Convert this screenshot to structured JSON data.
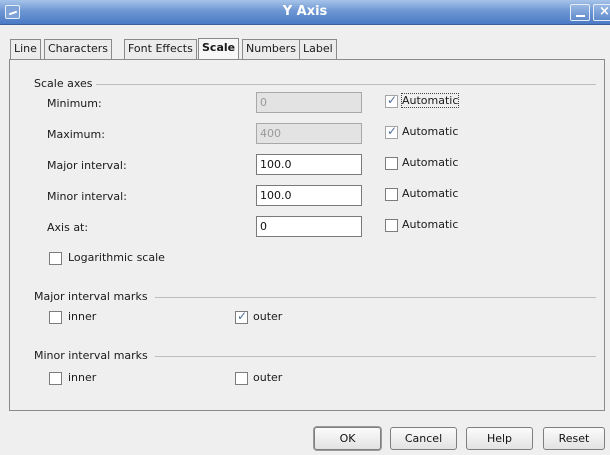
{
  "window": {
    "title": "Y Axis"
  },
  "tabs": [
    {
      "label": "Line"
    },
    {
      "label": "Characters"
    },
    {
      "label": "Font Effects"
    },
    {
      "label": "Scale"
    },
    {
      "label": "Numbers"
    },
    {
      "label": "Label"
    }
  ],
  "scale_axes": {
    "label": "Scale axes",
    "minimum": {
      "label": "Minimum:",
      "value": "0",
      "automatic_label": "Automatic",
      "automatic": true
    },
    "maximum": {
      "label": "Maximum:",
      "value": "400",
      "automatic_label": "Automatic",
      "automatic": true
    },
    "major_interval": {
      "label": "Major interval:",
      "value": "100.0",
      "automatic_label": "Automatic",
      "automatic": false
    },
    "minor_interval": {
      "label": "Minor interval:",
      "value": "100.0",
      "automatic_label": "Automatic",
      "automatic": false
    },
    "axis_at": {
      "label": "Axis at:",
      "value": "0",
      "automatic_label": "Automatic",
      "automatic": false
    },
    "logarithmic": {
      "label": "Logarithmic scale",
      "checked": false
    }
  },
  "major_marks": {
    "label": "Major interval marks",
    "inner": {
      "label": "inner",
      "checked": false
    },
    "outer": {
      "label": "outer",
      "checked": true
    }
  },
  "minor_marks": {
    "label": "Minor interval marks",
    "inner": {
      "label": "inner",
      "checked": false
    },
    "outer": {
      "label": "outer",
      "checked": false
    }
  },
  "buttons": {
    "ok": "OK",
    "cancel": "Cancel",
    "help": "Help",
    "reset": "Reset"
  },
  "check_glyph": "✓"
}
